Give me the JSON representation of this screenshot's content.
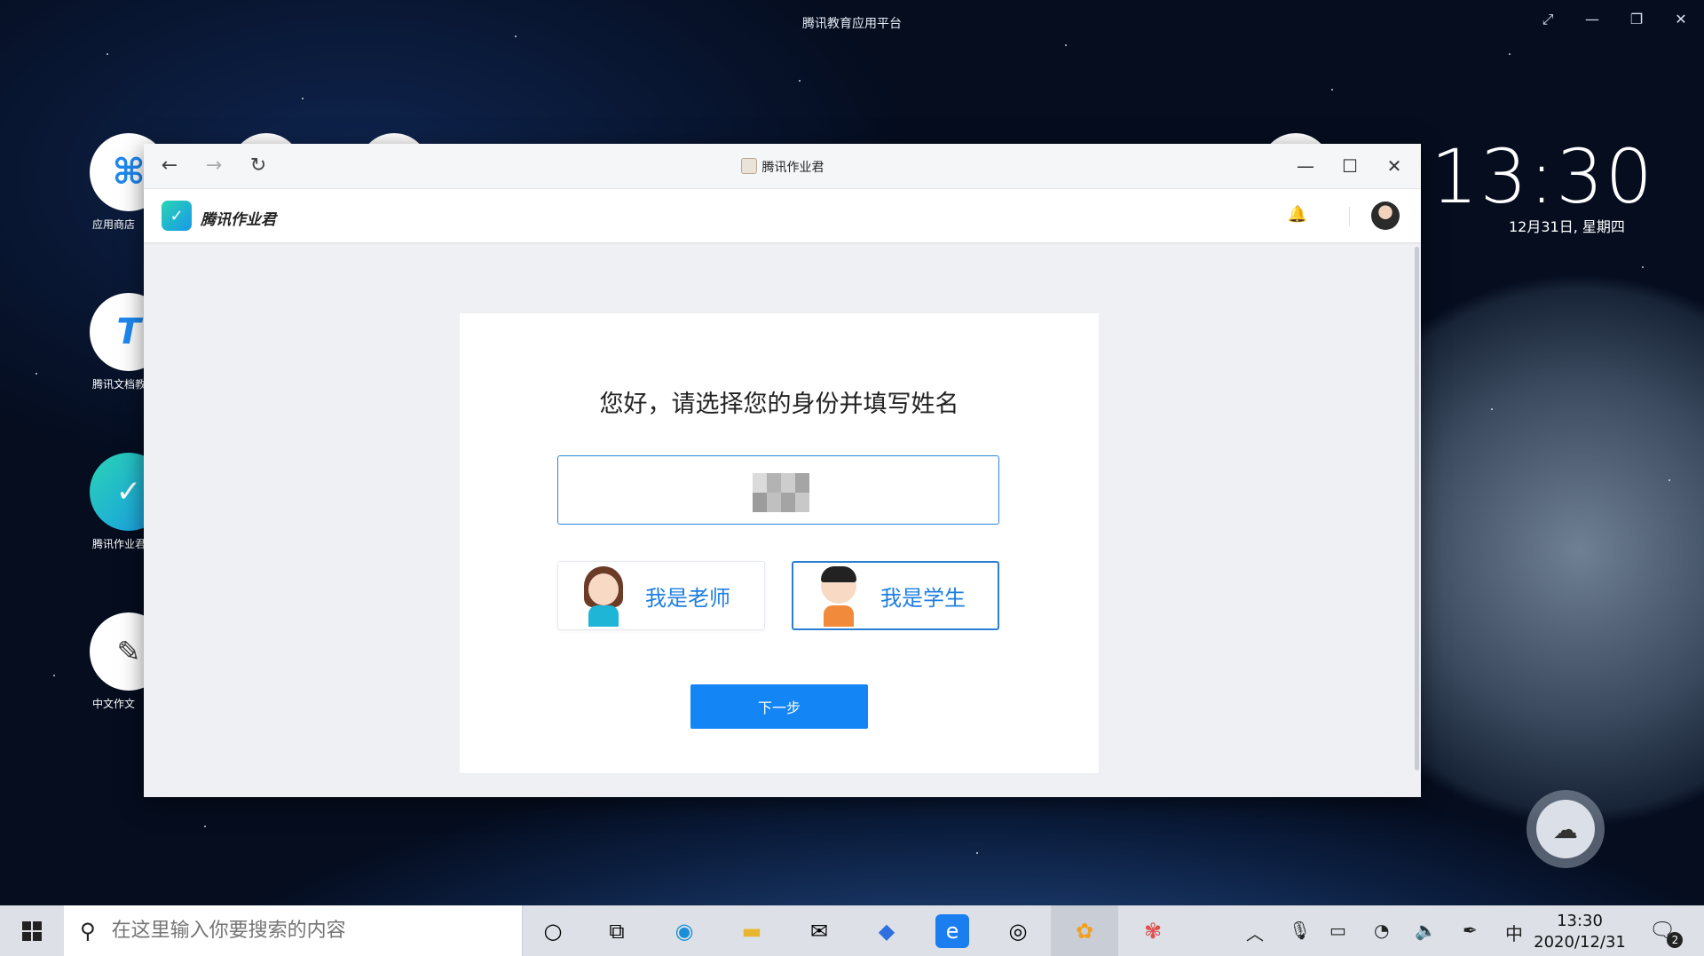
{
  "system": {
    "platform_title": "腾讯教育应用平台",
    "controls": [
      "⤢",
      "—",
      "❐",
      "✕"
    ],
    "clock_time": "13:30",
    "clock_date": "12月31日, 星期四"
  },
  "desktop_icons": [
    {
      "label": "应用商店",
      "icon": "app-store-icon"
    },
    {
      "label": "腾讯文档教育",
      "icon": "tencent-docs-icon"
    },
    {
      "label": "腾讯作业君",
      "icon": "homework-icon"
    },
    {
      "label": "中文作文",
      "icon": "composition-icon"
    }
  ],
  "window": {
    "title": "腾讯作业君",
    "nav": {
      "back": "←",
      "forward": "→",
      "reload": "↻"
    },
    "controls": {
      "minimize": "—",
      "maximize": "☐",
      "close": "✕"
    }
  },
  "app": {
    "name": "腾讯作业君",
    "bell": "🔔"
  },
  "form": {
    "heading": "您好，请选择您的身份并填写姓名",
    "name_value": "",
    "teacher_label": "我是老师",
    "student_label": "我是学生",
    "selected_role": "student",
    "next_label": "下一步"
  },
  "taskbar": {
    "search_placeholder": "在这里输入你要搜索的内容",
    "search_icon": "⚲",
    "time": "13:30",
    "date": "2020/12/31",
    "ime": "中",
    "notification_count": "2"
  },
  "colors": {
    "accent": "#1485f5",
    "role_label": "#1e7fe0",
    "input_border": "#2f86d6"
  }
}
